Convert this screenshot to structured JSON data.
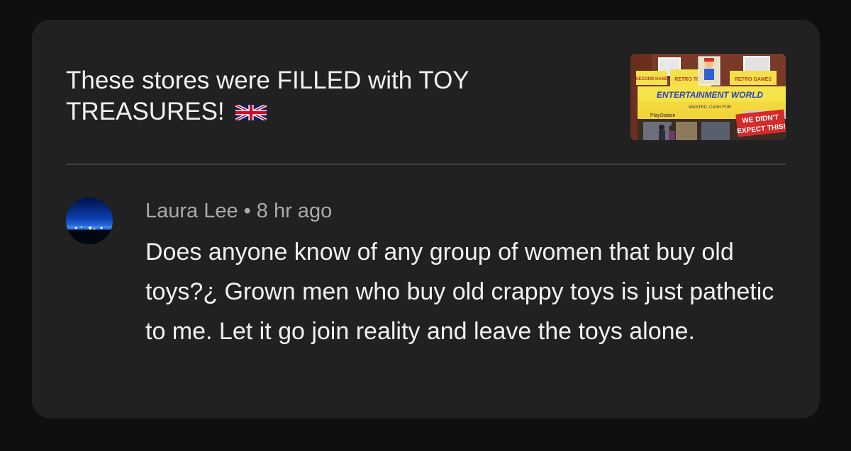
{
  "video": {
    "title": "These stores were FILLED with TOY TREASURES!",
    "title_icon": "uk-flag-icon",
    "thumbnail": {
      "sign_main": "ENTERTAINMENT WORLD",
      "sign_top_left": "SECOND HAND",
      "sign_top_mid": "RETRO TOYS",
      "sign_top_right": "RETRO GAMES",
      "sign_brand": "PlayStation",
      "sign_sub": "WANTED: CASH FOR",
      "overlay_line1": "WE DIDN'T",
      "overlay_line2": "EXPECT THIS!"
    }
  },
  "comment": {
    "author": "Laura Lee",
    "separator": "•",
    "time": "8 hr ago",
    "text": "Does anyone know of any group of women that buy old toys?¿ Grown men who buy old crappy toys is just pathetic to me. Let it go join reality and leave the toys alone.",
    "avatar_icon": "night-cityscape-avatar"
  },
  "colors": {
    "page_bg": "#0f0f0f",
    "card_bg": "#212121",
    "primary_text": "#f1f1f1",
    "secondary_text": "#aaaaaa",
    "divider": "#3f3f3f",
    "overlay_red": "#d42a2a"
  }
}
